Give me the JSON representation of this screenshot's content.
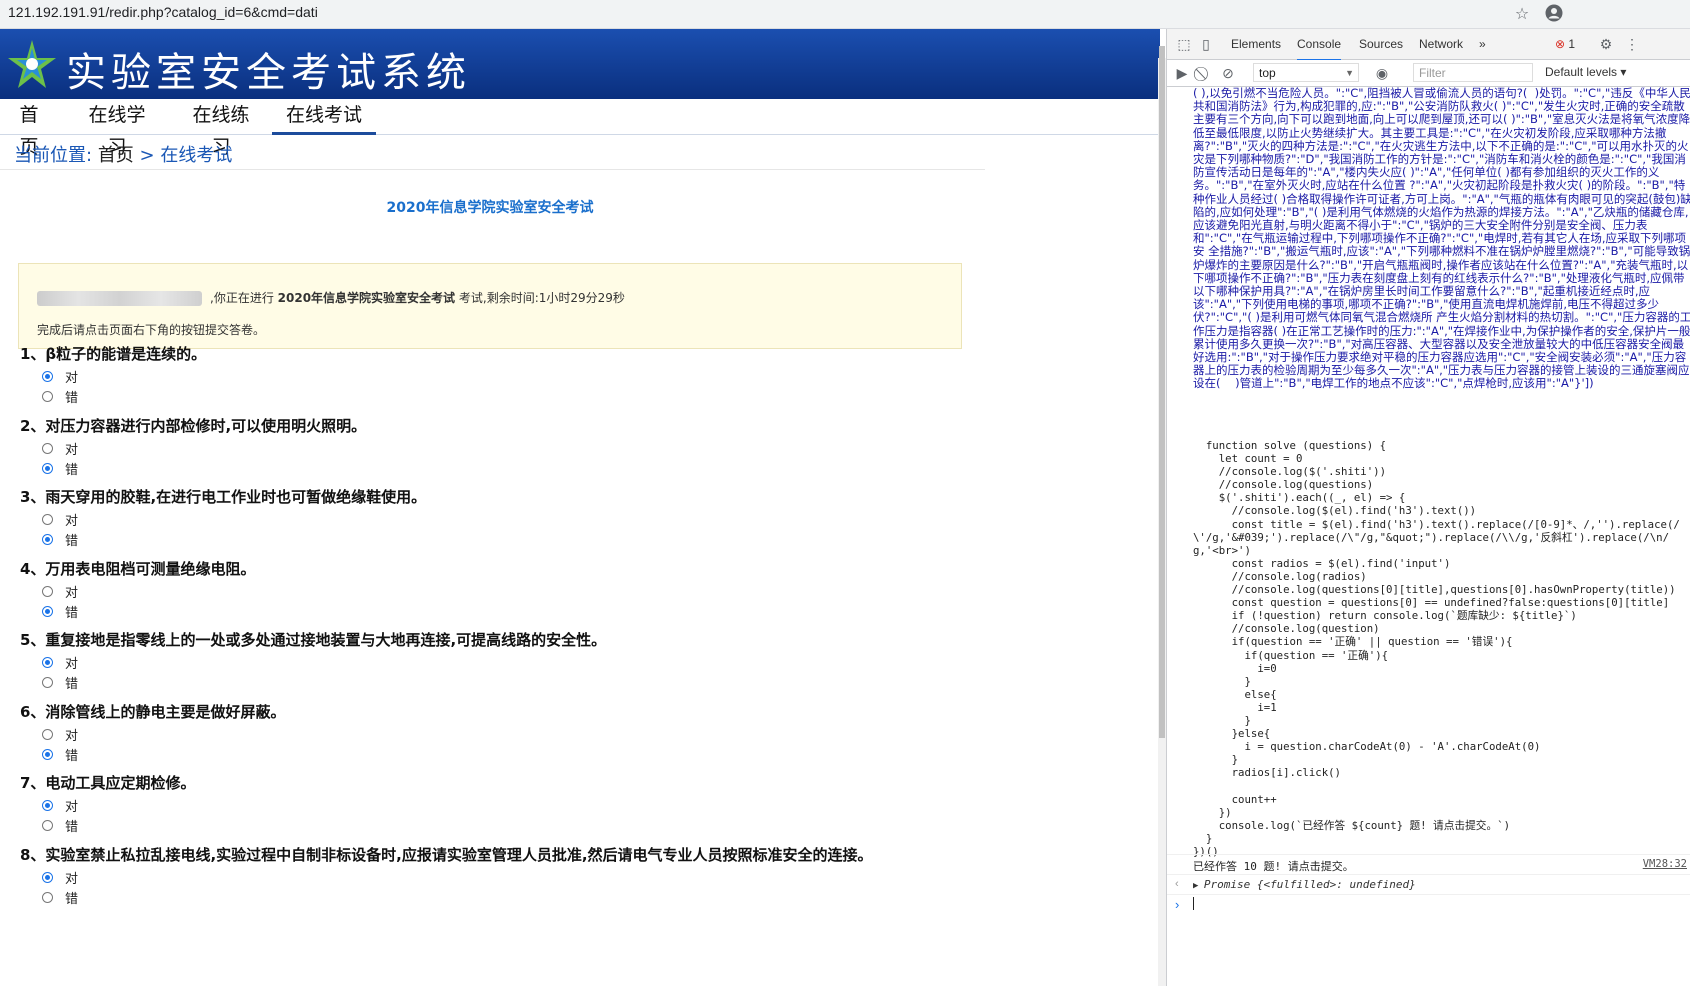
{
  "browser": {
    "url": "121.192.191.91/redir.php?catalog_id=6&cmd=dati"
  },
  "site": {
    "title": "实验室安全考试系统"
  },
  "nav": {
    "items": [
      "首页",
      "在线学习",
      "在线练习",
      "在线考试"
    ],
    "active": "在线考试"
  },
  "breadcrumb": {
    "label": "当前位置:",
    "home": "首页",
    "sep": ">",
    "current": "在线考试"
  },
  "exam": {
    "title": "2020年信息学院实验室安全考试",
    "notice_prefix": ",你正在进行",
    "exam_name": "2020年信息学院实验室安全考试",
    "notice_mid": "考试,剩余时间:",
    "remaining": "1小时29分29秒",
    "notice_line2": "完成后请点击页面右下角的按钮提交答卷。",
    "option_true": "对",
    "option_false": "错"
  },
  "questions": [
    {
      "text": "1、β粒子的能谱是连续的。",
      "selected": "对"
    },
    {
      "text": "2、对压力容器进行内部检修时,可以使用明火照明。",
      "selected": "错"
    },
    {
      "text": "3、雨天穿用的胶鞋,在进行电工作业时也可暂做绝缘鞋使用。",
      "selected": "错"
    },
    {
      "text": "4、万用表电阻档可测量绝缘电阻。",
      "selected": "错"
    },
    {
      "text": "5、重复接地是指零线上的一处或多处通过接地装置与大地再连接,可提高线路的安全性。",
      "selected": "对"
    },
    {
      "text": "6、消除管线上的静电主要是做好屏蔽。",
      "selected": "错"
    },
    {
      "text": "7、电动工具应定期检修。",
      "selected": "对"
    },
    {
      "text": "8、实验室禁止私拉乱接电线,实验过程中自制非标设备时,应报请实验室管理人员批准,然后请电气专业人员按照标准安全的连接。",
      "selected": "对"
    }
  ],
  "devtools": {
    "tabs": [
      "Elements",
      "Console",
      "Sources",
      "Network"
    ],
    "active_tab": "Console",
    "more": "»",
    "error_count": "1",
    "context": "top",
    "filter_placeholder": "Filter",
    "levels": "Default levels ▾",
    "dump_text": "( ),以免引燃不当危险人员。\":\"C\",阻挡被人冒或偷流人员的语句?(  )处罚。\":\"C\",\"违反《中华人民共和国消防法》行为,构成犯罪的,应:\":\"B\",\"公安消防队救火( )\":\"C\",\"发生火灾时,正确的安全疏散主要有三个方向,向下可以跑到地面,向上可以爬到屋顶,还可以( )\":\"B\",\"室息灭火法是将氧气浓度降低至最低限度,以防止火势继续扩大。其主要工具是:\":\"C\",\"在火灾初发阶段,应采取哪种方法撤离?\":\"B\",\"灭火的四种方法是:\":\"C\",\"在火灾逃生方法中,以下不正确的是:\":\"C\",\"可以用水扑灭的火灾是下列哪种物质?\":\"D\",\"我国消防工作的方针是:\":\"C\",\"消防车和消火栓的颜色是:\":\"C\",\"我国消防宣传活动日是每年的\":\"A\",\"楼内失火应( )\":\"A\",\"任何单位( )都有参加组织的灭火工作的义务。\":\"B\",\"在室外灭火时,应站在什么位置 ?\":\"A\",\"火灾初起阶段是扑救火灾( )的阶段。\":\"B\",\"特种作业人员经过( )合格取得操作许可证者,方可上岗。\":\"A\",\"气瓶的瓶体有肉眼可见的突起(鼓包)缺陷的,应如何处理\":\"B\",\"( )是利用气体燃烧的火焰作为热源的焊接方法。\":\"A\",\"乙炔瓶的储藏仓库,应该避免阳光直射,与明火距离不得小于\":\"C\",\"锅炉的三大安全附件分别是安全阀、压力表和\":\"C\",\"在气瓶运输过程中,下列哪项操作不正确?\":\"C\",\"电焊时,若有其它人在场,应采取下列哪项安 全措施?\":\"B\",\"搬运气瓶时,应该\":\"A\",\"下列哪种燃料不准在锅炉炉膛里燃烧?\":\"B\",\"可能导致锅炉爆炸的主要原因是什么?\":\"B\",\"开启气瓶瓶阀时,操作者应该站在什么位置?\":\"A\",\"充装气瓶时,以下哪项操作不正确?\":\"B\",\"压力表在刻度盘上刻有的红线表示什么?\":\"B\",\"处理液化气瓶时,应佩带以下哪种保护用具?\":\"A\",\"在锅炉房里长时间工作要留意什么?\":\"B\",\"起重机接近经点时,应该\":\"A\",\"下列使用电梯的事项,哪项不正确?\":\"B\",\"使用直流电焊机施焊前,电压不得超过多少伏?\":\"C\",\"( )是利用可燃气体同氧气混合燃烧所 产生火焰分割材料的热切割。\":\"C\",\"压力容器的工作压力是指容器( )在正常工艺操作时的压力:\":\"A\",\"在焊接作业中,为保护操作者的安全,保护片一般累计使用多久更换一次?\":\"B\",\"对高压容器、大型容器以及安全泄放量较大的中低压容器安全阀最好选用:\":\"B\",\"对于操作压力要求绝对平稳的压力容器应选用\":\"C\",\"安全阀安装必须\":\"A\",\"压力容器上的压力表的检验周期为至少每多久一次\":\"A\",\"压力表与压力容器的接管上装设的三通旋塞阀应设在(    )管道上\":\"B\",\"电焊工作的地点不应该\":\"C\",\"点焊枪时,应该用\":\"A\"}'])",
    "code": "  function solve (questions) {\n    let count = 0\n    //console.log($('.shiti'))\n    //console.log(questions)\n    $('.shiti').each((_, el) => {\n      //console.log($(el).find('h3').text())\n      const title = $(el).find('h3').text().replace(/[0-9]*、/,'').replace(/\\'/g,'&#039;').replace(/\\\"/g,\"&quot;\").replace(/\\\\/g,'反斜杠').replace(/\\n/g,'<br>')\n      const radios = $(el).find('input')\n      //console.log(radios)\n      //console.log(questions[0][title],questions[0].hasOwnProperty(title))\n      const question = questions[0] == undefined?false:questions[0][title]\n      if (!question) return console.log(`题库缺少: ${title}`)\n      //console.log(question)\n      if(question == '正确' || question == '错误'){\n        if(question == '正确'){\n          i=0\n        }\n        else{\n          i=1\n        }\n      }else{\n        i = question.charCodeAt(0) - 'A'.charCodeAt(0)\n      }\n      radios[i].click()\n\n      count++\n    })\n    console.log(`已经作答 ${count} 题! 请点击提交。`)\n  }\n})()",
    "log_message": "已经作答 10 题! 请点击提交。",
    "log_source": "VM28:32",
    "promise_text": "Promise {<fulfilled>: undefined}"
  },
  "colors": {
    "banner": "#1b4fb0",
    "link": "#1a57b5",
    "radio_selected": "#1a73e8"
  }
}
